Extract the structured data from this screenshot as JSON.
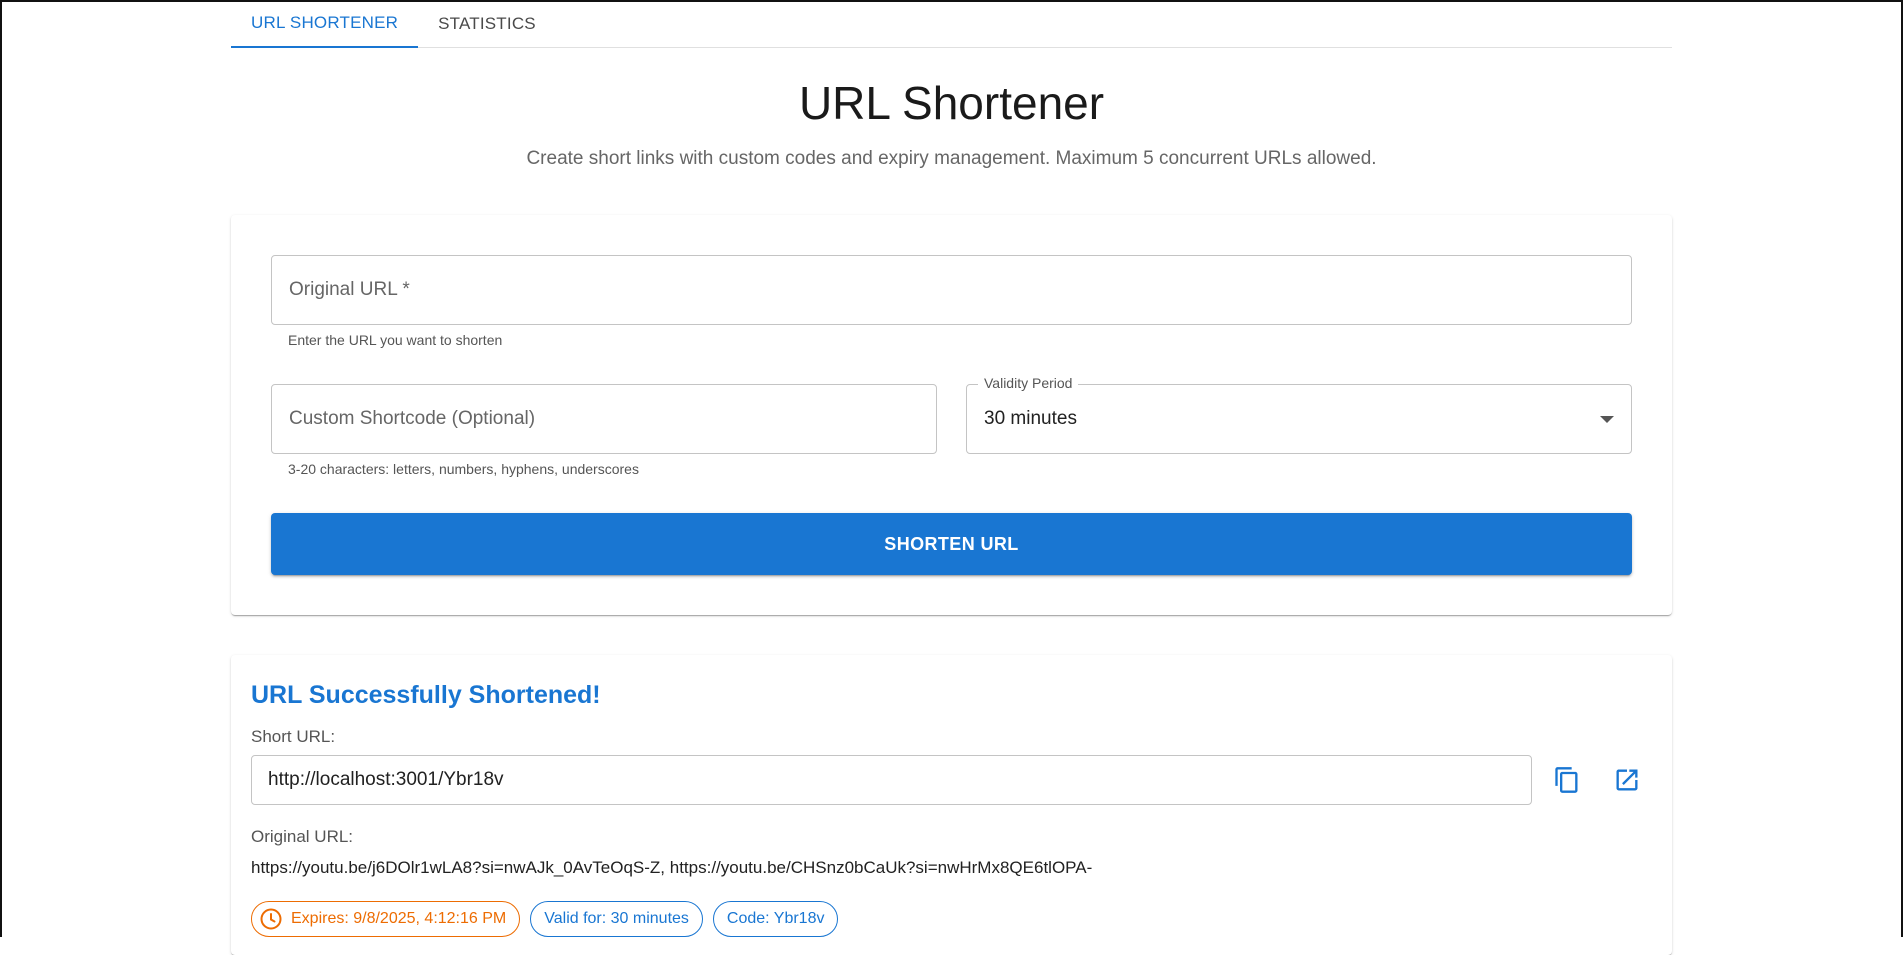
{
  "tabs": [
    {
      "label": "URL SHORTENER",
      "active": true
    },
    {
      "label": "STATISTICS",
      "active": false
    }
  ],
  "header": {
    "title": "URL Shortener",
    "subtitle": "Create short links with custom codes and expiry management. Maximum 5 concurrent URLs allowed."
  },
  "form": {
    "url_placeholder": "Original URL *",
    "url_value": "",
    "url_helper": "Enter the URL you want to shorten",
    "code_placeholder": "Custom Shortcode (Optional)",
    "code_value": "",
    "code_helper": "3-20 characters: letters, numbers, hyphens, underscores",
    "validity_label": "Validity Period",
    "validity_value": "30 minutes",
    "submit_label": "SHORTEN URL"
  },
  "result": {
    "title": "URL Successfully Shortened!",
    "short_label": "Short URL:",
    "short_url": "http://localhost:3001/Ybr18v",
    "original_label": "Original URL:",
    "original_url": "https://youtu.be/j6DOlr1wLA8?si=nwAJk_0AvTeOqS-Z, https://youtu.be/CHSnz0bCaUk?si=nwHrMx8QE6tlOPA-",
    "chips": {
      "expires": "Expires: 9/8/2025, 4:12:16 PM",
      "valid_for": "Valid for: 30 minutes",
      "code": "Code: Ybr18v"
    }
  },
  "colors": {
    "primary": "#1976d2",
    "warning": "#ed6c02"
  },
  "icons": {
    "copy": "copy-icon",
    "open": "open-in-new-icon",
    "clock": "clock-icon",
    "dropdown": "chevron-down-icon"
  }
}
